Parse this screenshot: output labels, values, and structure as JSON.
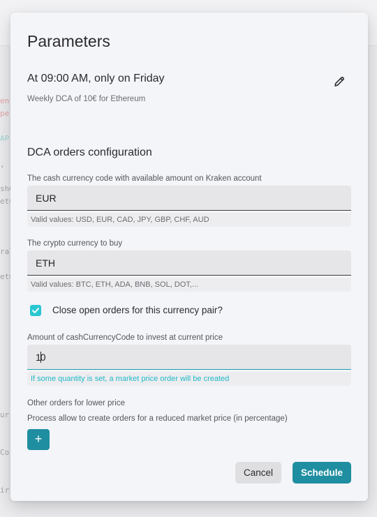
{
  "background": {
    "fragments": [
      {
        "text": "ent",
        "tone": "red"
      },
      {
        "text": "pe",
        "tone": "red"
      },
      {
        "text": "API",
        "tone": "teal"
      },
      {
        "text": ",",
        "tone": "grey"
      },
      {
        "text": "shCu",
        "tone": "grey"
      },
      {
        "text": "etu",
        "tone": "grey"
      },
      {
        "text": "ral",
        "tone": "grey"
      },
      {
        "text": "etu",
        "tone": "grey"
      },
      {
        "text": "ur",
        "tone": "grey"
      },
      {
        "text": "Co",
        "tone": "grey"
      },
      {
        "text": "ir",
        "tone": "grey"
      }
    ]
  },
  "dialog": {
    "title": "Parameters",
    "schedule": {
      "summary": "At 09:00 AM, only on Friday",
      "description": "Weekly DCA of 10€ for Ethereum",
      "edit_icon": "pencil-icon"
    },
    "section_title": "DCA orders configuration",
    "cash_currency": {
      "label": "The cash currency code with available amount on Kraken account",
      "value": "EUR",
      "hint": "Valid values: USD, EUR, CAD, JPY, GBP, CHF, AUD"
    },
    "crypto_currency": {
      "label": "The crypto currency to buy",
      "value": "ETH",
      "hint": "Valid values: BTC, ETH, ADA, BNB, SOL, DOT,..."
    },
    "close_orders": {
      "label": "Close open orders for this currency pair?",
      "checked": true
    },
    "amount": {
      "label": "Amount of cashCurrencyCode to invest at current price",
      "value_before_caret": "1",
      "value_after_caret": "0",
      "hint": "If some quantity is set, a market price order will be created"
    },
    "other_orders": {
      "label": "Other orders for lower price",
      "description": "Process allow to create orders for a reduced market price (in percentage)",
      "add_label": "+"
    },
    "buttons": {
      "cancel": "Cancel",
      "schedule": "Schedule"
    }
  },
  "colors": {
    "accent": "#1e8ea0",
    "checkbox": "#29c6d2",
    "hint_teal": "#21b9c6"
  }
}
